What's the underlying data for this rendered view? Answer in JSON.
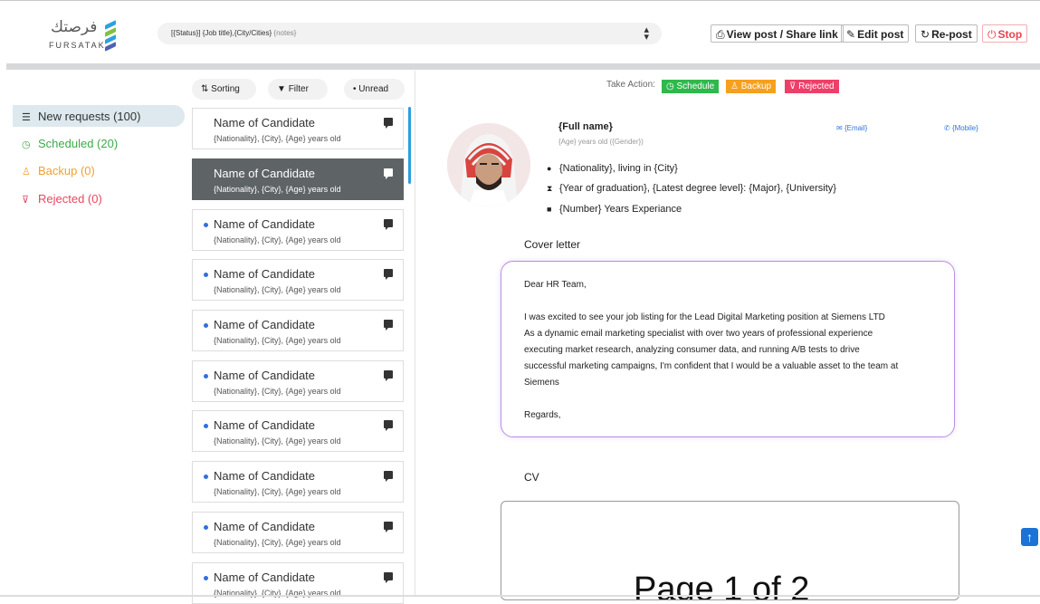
{
  "brand": {
    "arabic": "فرصتك",
    "english": "FURSATAK",
    "colors": [
      "#2ba2e0",
      "#7fc241",
      "#2ba2e0",
      "#5161b8"
    ]
  },
  "job_select": {
    "text": "[{Status}] {Job title},{City/Cities}",
    "notes": "{notes}",
    "icon": "updown-arrows-icon"
  },
  "header_buttons": {
    "view_post": {
      "label": "View post / Share link",
      "icon": "share-icon"
    },
    "edit_post": {
      "label": "Edit post",
      "icon": "edit-icon"
    },
    "repost": {
      "label": "Re-post",
      "icon": "refresh-icon"
    },
    "stop": {
      "label": "Stop",
      "icon": "power-icon"
    }
  },
  "sidebar": {
    "items": [
      {
        "label": "New requests (100)",
        "icon": "list-icon"
      },
      {
        "label": "Scheduled (20)",
        "icon": "clock-icon"
      },
      {
        "label": "Backup (0)",
        "icon": "user-icon"
      },
      {
        "label": "Rejected (0)",
        "icon": "thumbs-down-icon"
      }
    ]
  },
  "list_controls": {
    "sorting": "Sorting",
    "filter": "Filter",
    "unread": "Unread"
  },
  "candidates": [
    {
      "name": "Name of Candidate",
      "info": "{Nationality}, {City}, {Age} years old",
      "unread": false,
      "selected": false
    },
    {
      "name": "Name of Candidate",
      "info": "{Nationality}, {City}, {Age} years old",
      "unread": false,
      "selected": true
    },
    {
      "name": "Name of Candidate",
      "info": "{Nationality}, {City}, {Age} years old",
      "unread": true,
      "selected": false
    },
    {
      "name": "Name of Candidate",
      "info": "{Nationality}, {City}, {Age} years old",
      "unread": true,
      "selected": false
    },
    {
      "name": "Name of Candidate",
      "info": "{Nationality}, {City}, {Age} years old",
      "unread": true,
      "selected": false
    },
    {
      "name": "Name of Candidate",
      "info": "{Nationality}, {City}, {Age} years old",
      "unread": true,
      "selected": false
    },
    {
      "name": "Name of Candidate",
      "info": "{Nationality}, {City}, {Age} years old",
      "unread": true,
      "selected": false
    },
    {
      "name": "Name of Candidate",
      "info": "{Nationality}, {City}, {Age} years old",
      "unread": true,
      "selected": false
    },
    {
      "name": "Name of Candidate",
      "info": "{Nationality}, {City}, {Age} years old",
      "unread": true,
      "selected": false
    },
    {
      "name": "Name of Candidate",
      "info": "{Nationality}, {City}, {Age} years old",
      "unread": true,
      "selected": false
    }
  ],
  "actions": {
    "take_action": "Take Action:",
    "schedule": "Schedule",
    "backup": "Backup",
    "rejected": "Rejected"
  },
  "profile": {
    "full_name": "{Full name}",
    "age_gender": "{Age} years old ({Gender})",
    "email": "{Email}",
    "mobile": "{Mobile}",
    "location": "{Nationality}, living in {City}",
    "education": "{Year of graduation}, {Latest degree level}: {Major}, {University}",
    "experience": "{Number} Years Experiance"
  },
  "cover_letter": {
    "title": "Cover letter",
    "greeting": "Dear HR Team,",
    "body": [
      "I was excited to see your job listing for the Lead Digital Marketing position at Siemens LTD",
      "As a dynamic email marketing specialist with over two years of professional experience",
      "executing market research, analyzing consumer data, and running A/B tests to drive",
      "successful marketing campaigns, I'm confident that I would be a valuable asset to the team at",
      "Siemens"
    ],
    "closing": "Regards,"
  },
  "cv": {
    "title": "CV",
    "page_text": "Page 1 of 2"
  },
  "scroll_top": {
    "icon": "arrow-up-icon"
  }
}
